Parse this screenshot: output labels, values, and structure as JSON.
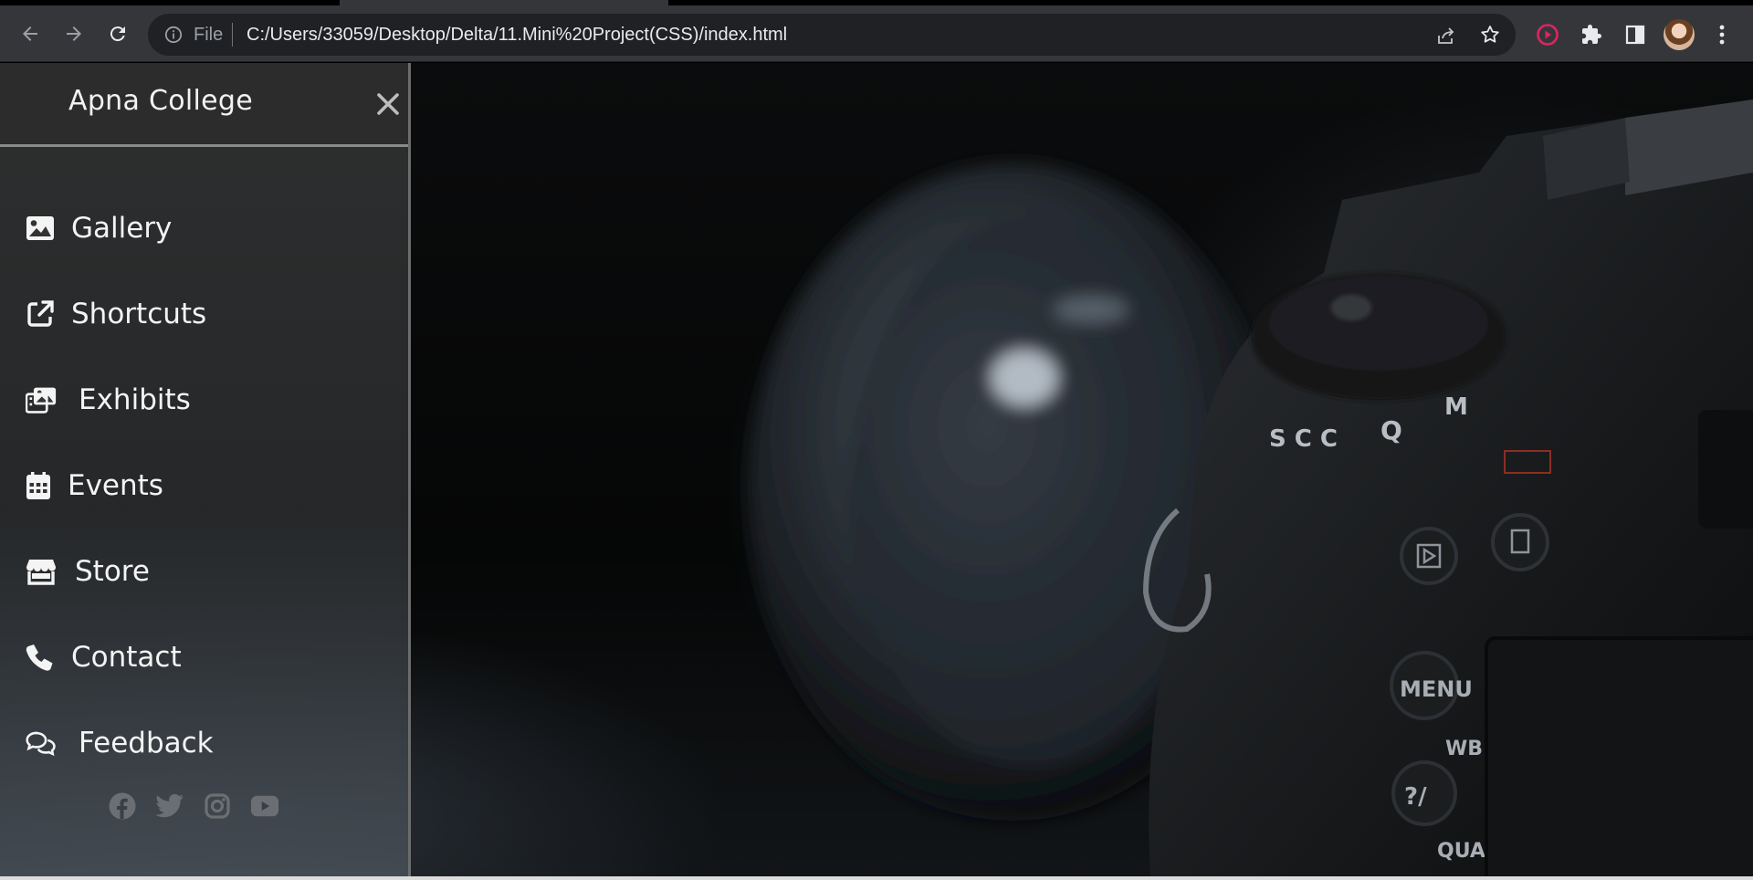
{
  "browser": {
    "scheme_label": "File",
    "url": "C:/Users/33059/Desktop/Delta/11.Mini%20Project(CSS)/index.html",
    "icons": [
      "back-icon",
      "forward-icon",
      "reload-icon",
      "info-icon",
      "share-icon",
      "star-icon",
      "record-icon",
      "extensions-icon",
      "side-panel-icon",
      "profile-avatar",
      "menu-icon"
    ]
  },
  "sidebar": {
    "brand": "Apna College",
    "close_icon": "close-icon",
    "items": [
      {
        "label": "Gallery",
        "icon": "image-icon"
      },
      {
        "label": "Shortcuts",
        "icon": "external-link-icon"
      },
      {
        "label": "Exhibits",
        "icon": "photo-stack-icon"
      },
      {
        "label": "Events",
        "icon": "calendar-icon"
      },
      {
        "label": "Store",
        "icon": "store-icon"
      },
      {
        "label": "Contact",
        "icon": "phone-icon"
      },
      {
        "label": "Feedback",
        "icon": "comments-icon"
      }
    ],
    "socials": [
      "facebook-icon",
      "twitter-icon",
      "instagram-icon",
      "youtube-icon"
    ]
  },
  "colors": {
    "chrome_bg": "#35363a",
    "omnibox_bg": "#202124",
    "sidebar_text": "#f4f4f4",
    "social_icon": "#6b6f73",
    "record_red": "#e0245e"
  }
}
